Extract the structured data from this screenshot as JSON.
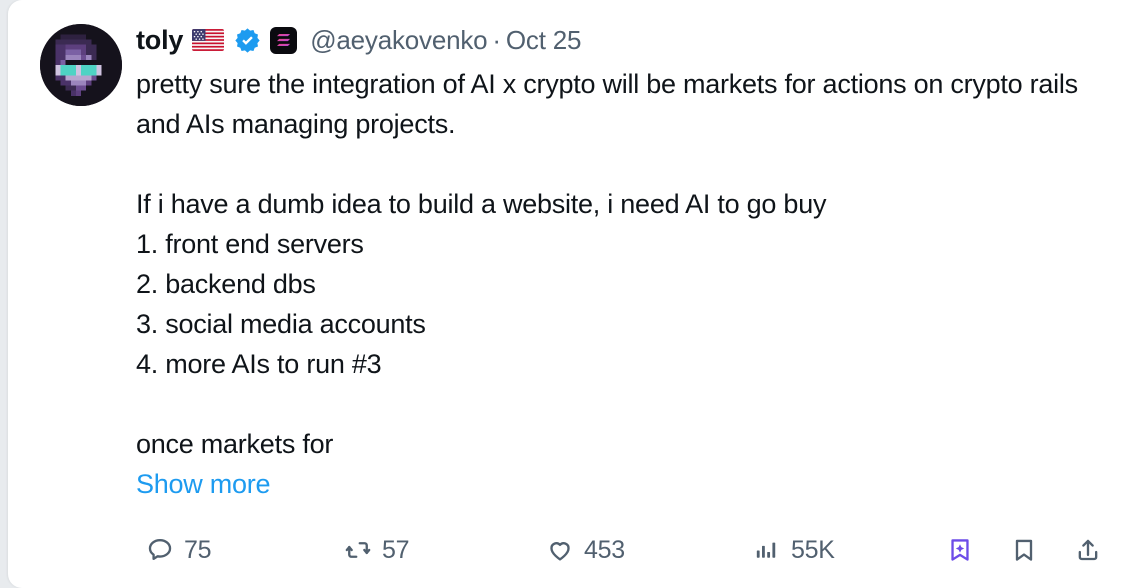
{
  "tweet": {
    "author": {
      "display_name": "toly",
      "handle": "@aeyakovenko",
      "flag": "🇺🇸",
      "verified_icon": "verified-badge-icon",
      "affiliate_icon": "solana-logo-icon",
      "avatar_alt": "pixel-art-avatar"
    },
    "separator": "·",
    "timestamp": "Oct 25",
    "body": "pretty sure the integration of AI x crypto will be markets for actions on crypto rails and AIs managing projects.\n\nIf i have a dumb idea to build a website, i need AI to go buy\n1. front end servers\n2. backend dbs\n3. social media accounts\n4. more AIs to run #3\n\nonce markets for",
    "show_more_label": "Show more"
  },
  "actions": {
    "reply": {
      "icon": "reply-icon",
      "count": "75"
    },
    "repost": {
      "icon": "retweet-icon",
      "count": "57"
    },
    "like": {
      "icon": "heart-icon",
      "count": "453"
    },
    "views": {
      "icon": "analytics-icon",
      "count": "55K"
    },
    "grok": {
      "icon": "grok-bookmark-sparkle-icon",
      "count": ""
    },
    "bookmark": {
      "icon": "bookmark-icon",
      "count": ""
    },
    "share": {
      "icon": "share-icon",
      "count": ""
    }
  },
  "colors": {
    "page_background": "#e8ebee",
    "card_background": "#ffffff",
    "text_primary": "#0f1419",
    "text_secondary": "#51606f",
    "link_blue": "#1d9bf0",
    "verified_blue": "#1d9bf0",
    "grok_purple": "#6c4ce8"
  }
}
